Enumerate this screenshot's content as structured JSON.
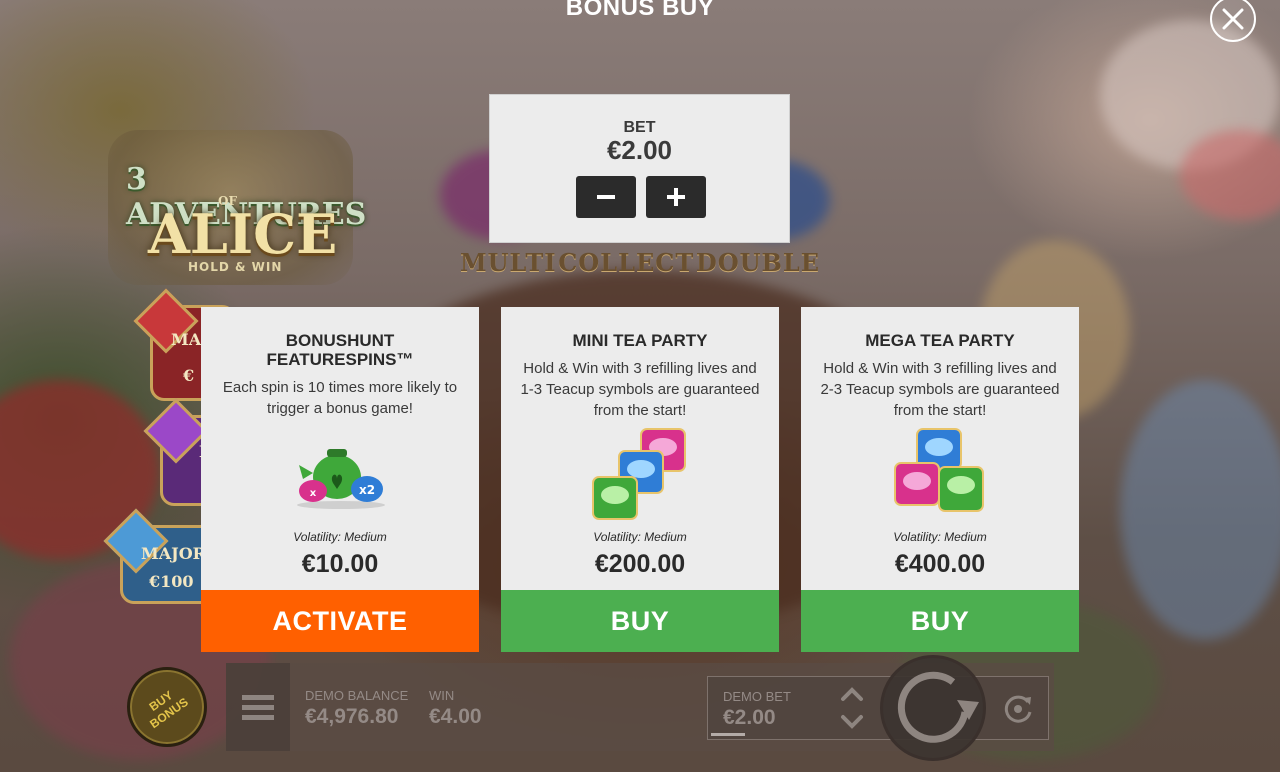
{
  "overlay": {
    "title": "BONUS BUY"
  },
  "bet_selector": {
    "label": "BET",
    "value": "€2.00"
  },
  "cards": [
    {
      "name_line1": "BONUSHUNT",
      "name_line2": "FEATURESPINS™",
      "description": "Each spin is 10 times more likely to trigger a bonus game!",
      "volatility": "Volatility: Medium",
      "price": "€10.00",
      "action": "ACTIVATE",
      "action_color": "#ff6000"
    },
    {
      "name_line1": "MINI TEA PARTY",
      "name_line2": "",
      "description": "Hold & Win with 3 refilling lives and 1-3 Teacup symbols are guaranteed from the start!",
      "volatility": "Volatility: Medium",
      "price": "€200.00",
      "action": "BUY",
      "action_color": "#4caf50"
    },
    {
      "name_line1": "MEGA TEA PARTY",
      "name_line2": "",
      "description": "Hold & Win with 3 refilling lives and 2-3 Teacup symbols are guaranteed from the start!",
      "volatility": "Volatility: Medium",
      "price": "€400.00",
      "action": "BUY",
      "action_color": "#4caf50"
    }
  ],
  "game": {
    "logo_line1": "3 ADVENTURES",
    "logo_line2": "OF",
    "logo_line3": "ALICE",
    "logo_line4": "HOLD & WIN",
    "reel_labels": [
      "MULTI",
      "COLLECT",
      "DOUBLE"
    ],
    "jackpots": [
      {
        "label": "MA",
        "value": "€"
      },
      {
        "label": "M",
        "value": ""
      },
      {
        "label": "MAJOR",
        "value": "€100"
      }
    ]
  },
  "bottom_bar": {
    "buy_bonus_label_1": "BUY",
    "buy_bonus_label_2": "BONUS",
    "balance_label": "DEMO BALANCE",
    "balance_value": "€4,976.80",
    "win_label": "WIN",
    "win_value": "€4.00",
    "bet_label": "DEMO BET",
    "bet_value": "€2.00"
  },
  "icons": {
    "close": "close-icon",
    "minus": "minus-icon",
    "plus": "plus-icon",
    "menu": "hamburger-menu-icon",
    "spin": "spin-arrow-icon",
    "autoplay": "autoplay-icon",
    "bet_up": "chevron-up-icon",
    "bet_down": "chevron-down-icon"
  },
  "colors": {
    "activate": "#ff6000",
    "buy": "#4caf50",
    "card_bg": "#ececec"
  }
}
